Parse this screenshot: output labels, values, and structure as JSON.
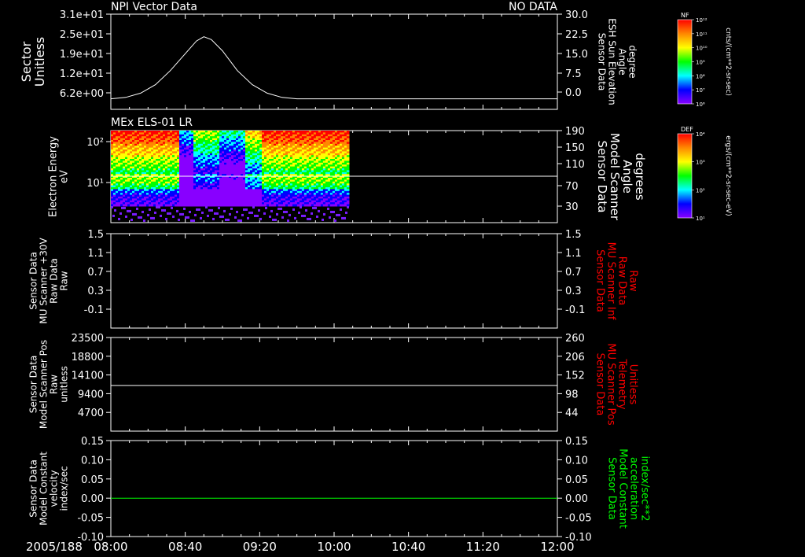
{
  "date_label": "2005/188",
  "time_ticks": [
    "08:00",
    "08:40",
    "09:20",
    "10:00",
    "10:40",
    "11:20",
    "12:00"
  ],
  "chart_data": [
    {
      "type": "line",
      "title": "NPI Vector Data",
      "status": "NO DATA",
      "ylabel_left": [
        "Sector",
        "Unitless"
      ],
      "ylabel_right": [
        "Sensor Data",
        "ESH Sun Elevation",
        "Angle",
        "degree"
      ],
      "left_ticks": [
        "3.1e+01",
        "2.5e+01",
        "1.9e+01",
        "1.2e+01",
        "6.2e+00"
      ],
      "right_ticks": [
        "30.0",
        "22.5",
        "15.0",
        "7.5",
        "0.0"
      ],
      "ylim": [
        -3.75,
        30
      ],
      "series": [
        {
          "color": "#ffffff",
          "points": [
            [
              0,
              0
            ],
            [
              8,
              0.5
            ],
            [
              16,
              2
            ],
            [
              24,
              5
            ],
            [
              32,
              10
            ],
            [
              40,
              16
            ],
            [
              46,
              20.5
            ],
            [
              50,
              22
            ],
            [
              54,
              21
            ],
            [
              60,
              17
            ],
            [
              68,
              10
            ],
            [
              76,
              5
            ],
            [
              84,
              2
            ],
            [
              92,
              0.5
            ],
            [
              100,
              0
            ],
            [
              240,
              0
            ]
          ]
        }
      ]
    },
    {
      "type": "heatmap",
      "title": "MEx ELS-01 LR",
      "ylabel_left": [
        "Electron Energy",
        "eV"
      ],
      "ylabel_right": [
        "Sensor Data",
        "Model Scanner",
        "Angle",
        "degrees"
      ],
      "left_ticks": [
        "10²",
        "10¹"
      ],
      "right_ticks": [
        "190",
        "150",
        "110",
        "70",
        "30"
      ],
      "data_end_minutes": 128,
      "overlay_line": {
        "color": "#ffffff",
        "value_deg": 92
      },
      "color_scale": [
        "#ff0000",
        "#ff8800",
        "#ffff00",
        "#00ff00",
        "#00ffff",
        "#0000ff",
        "#8800ff"
      ]
    },
    {
      "type": "line",
      "ylabel_left": [
        "Sensor Data",
        "MU Scanner +30V",
        "Raw Data",
        "Raw"
      ],
      "ylabel_right": [
        "Sensor Data",
        "MU Scanner Inf",
        "Raw Data",
        "Raw"
      ],
      "left_ticks": [
        "1.5",
        "1.1",
        "0.7",
        "0.3",
        "-0.1"
      ],
      "right_ticks": [
        "1.5",
        "1.1",
        "0.7",
        "0.3",
        "-0.1"
      ],
      "series": []
    },
    {
      "type": "line",
      "ylabel_left": [
        "Sensor Data",
        "Model Scanner Pos",
        "Raw",
        "unitless"
      ],
      "ylabel_right": [
        "Sensor Data",
        "MU Scanner Pos",
        "Telemetry",
        "Unitless"
      ],
      "left_ticks": [
        "23500",
        "18800",
        "14100",
        "9400",
        "4700"
      ],
      "right_ticks": [
        "260",
        "206",
        "152",
        "98",
        "44"
      ],
      "series": [
        {
          "color": "#ffffff",
          "value_left_units": 11000
        }
      ]
    },
    {
      "type": "line",
      "ylabel_left": [
        "Sensor Data",
        "Model Constant",
        "velocity",
        "index/sec"
      ],
      "ylabel_right": [
        "Sensor Data",
        "Model Constant",
        "acceleration",
        "index/sec**2"
      ],
      "left_ticks": [
        "0.15",
        "0.10",
        "0.05",
        "0.00",
        "-0.05",
        "-0.10"
      ],
      "right_ticks": [
        "0.15",
        "0.10",
        "0.05",
        "0.00",
        "-0.05",
        "-0.10"
      ],
      "ylim": [
        -0.1,
        0.15
      ],
      "series": [
        {
          "color": "#00ff00",
          "value": 0.0
        }
      ]
    }
  ],
  "colorbars": [
    {
      "tag": "NF",
      "label": "cnts/(cm**2-sr-sec)",
      "ticks": [
        "10¹²",
        "10¹¹",
        "10¹⁰",
        "10⁹",
        "10⁸",
        "10⁷",
        "10⁶"
      ]
    },
    {
      "tag": "DEF",
      "label": "ergs/(cm**2-sr-sec-eV)",
      "ticks": [
        "10⁴",
        "10³",
        "10²",
        "10¹"
      ]
    }
  ],
  "colors": {
    "background": "#000000",
    "axis": "#ffffff",
    "red_label": "#ff0000",
    "green_label": "#00ff00"
  }
}
